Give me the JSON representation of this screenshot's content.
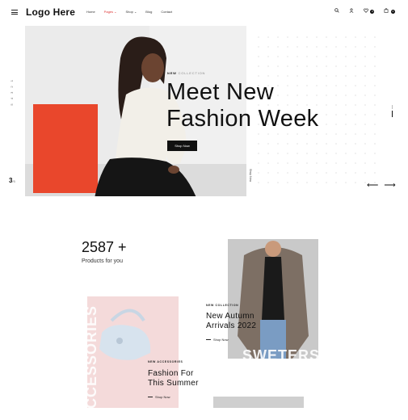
{
  "header": {
    "logo": "Logo Here",
    "nav": [
      {
        "label": "Home",
        "active": false
      },
      {
        "label": "Pages ⌄",
        "active": true
      },
      {
        "label": "Shop ⌄",
        "active": false
      },
      {
        "label": "Blog",
        "active": false
      },
      {
        "label": "Contact",
        "active": false
      }
    ],
    "wishlist_count": "0",
    "cart_count": "0"
  },
  "hero": {
    "eyebrow_strong": "NEW",
    "eyebrow_light": "COLLECTION",
    "title_line1": "Meet New",
    "title_line2": "Fashion Week",
    "button": "Shop Now",
    "vertical_nav": "5 4 3 2 1",
    "slide_current": "3",
    "slide_total": "/5",
    "vertical_link": "Shop Now",
    "colors": {
      "accent_red": "#e9472c",
      "dark": "#111111"
    }
  },
  "stats": {
    "number": "2587 +",
    "label": "Products for you"
  },
  "cards": [
    {
      "tag": "NEW ACCESSORIES",
      "title_line1": "Fashion For",
      "title_line2": "This Summer",
      "link": "Shop Now",
      "bg_word": "ACCESSORIES"
    },
    {
      "tag": "NEW COLLECTION",
      "title_line1": "New Autumn",
      "title_line2": "Arrivals 2022",
      "link": "Shop Now",
      "bg_word": "SWETERS"
    }
  ]
}
